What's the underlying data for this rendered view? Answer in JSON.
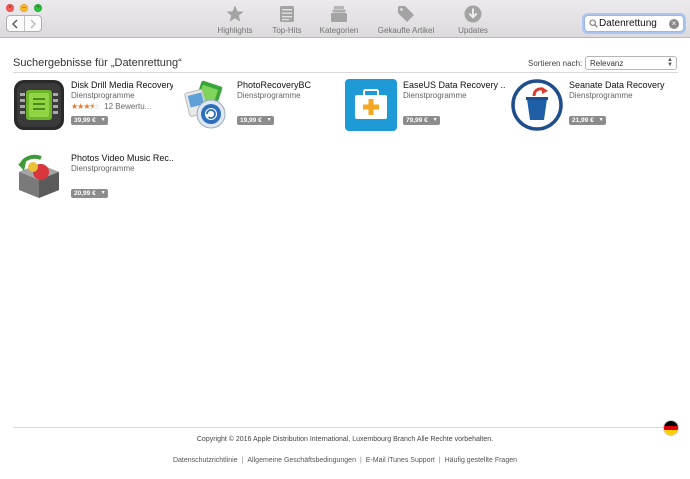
{
  "window": {
    "traffic_lights": [
      "close",
      "minimize",
      "zoom"
    ]
  },
  "toolbar": {
    "back_icon": "chevron-left-icon",
    "forward_icon": "chevron-right-icon",
    "tabs": [
      {
        "label": "Highlights",
        "icon": "star-icon"
      },
      {
        "label": "Top-Hits",
        "icon": "list-icon"
      },
      {
        "label": "Kategorien",
        "icon": "stack-icon"
      },
      {
        "label": "Gekaufte Artikel",
        "icon": "tag-icon"
      },
      {
        "label": "Updates",
        "icon": "download-icon"
      }
    ],
    "search": {
      "value": "Datenrettung",
      "icon": "search-icon",
      "clear_icon": "clear-icon"
    }
  },
  "results": {
    "title": "Suchergebnisse für „Datenrettung“",
    "sort_label": "Sortieren nach:",
    "sort_value": "Relevanz"
  },
  "apps": [
    {
      "name": "Disk Drill Media Recovery",
      "category": "Dienstprogramme",
      "price": "39,99 €",
      "rating": 3.5,
      "rating_count": "12 Bewertu..."
    },
    {
      "name": "PhotoRecoveryBC",
      "category": "Dienstprogramme",
      "price": "19,99 €"
    },
    {
      "name": "EaseUS Data Recovery ...",
      "category": "Dienstprogramme",
      "price": "79,99 €"
    },
    {
      "name": "Seanate Data Recovery",
      "category": "Dienstprogramme",
      "price": "21,99 €"
    },
    {
      "name": "Photos Video Music Rec...",
      "category": "Dienstprogramme",
      "price": "20,99 €"
    }
  ],
  "footer": {
    "copyright": "Copyright © 2016 Apple Distribution International, Luxembourg Branch Alle Rechte vorbehalten.",
    "links": [
      "Datenschutzrichtlinie",
      "Allgemeine Geschäftsbedingungen",
      "E-Mail iTunes Support",
      "Häufig gestellte Fragen"
    ],
    "separator": "|",
    "region_flag": "germany-flag-icon"
  },
  "colors": {
    "accent": "#3b8ad8",
    "price_badge": "#8c8c8c",
    "stars": "#e8752a"
  }
}
